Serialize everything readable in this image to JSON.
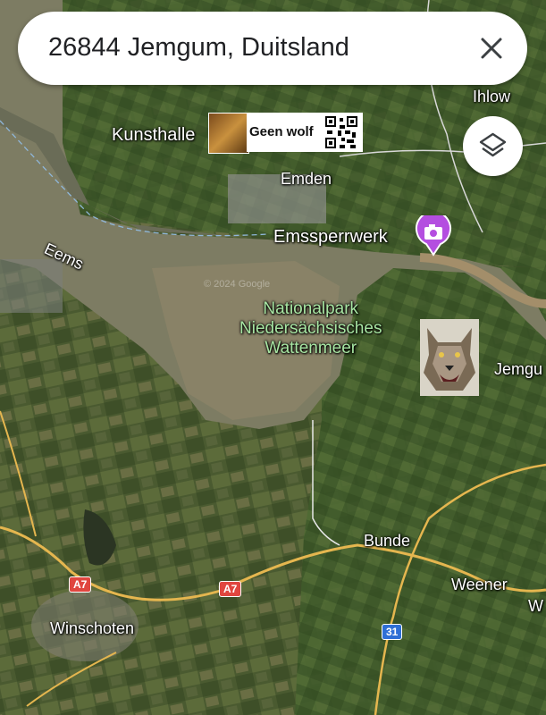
{
  "search": {
    "query": "26844 Jemgum, Duitsland"
  },
  "poi": {
    "geen_wolf": "Geen wolf"
  },
  "labels": {
    "ihlow": "Ihlow",
    "kunsthalle": "Kunsthalle",
    "emden": "Emden",
    "emssperrwerk": "Emssperrwerk",
    "eems": "Eems",
    "park_line1": "Nationalpark",
    "park_line2": "Niedersächsisches",
    "park_line3": "Wattenmeer",
    "jemgum": "Jemgu",
    "bunde": "Bunde",
    "weener": "Weener",
    "w": "W",
    "winschoten": "Winschoten",
    "copyright": "© 2024 Google"
  },
  "road_shields": {
    "a7": "A7",
    "r31": "31"
  },
  "icons": {
    "close": "close-icon",
    "layers": "layers-icon",
    "camera": "camera-pin-icon"
  },
  "colors": {
    "park_label": "#a8e6a3",
    "a7_shield": "#e0463f",
    "r31_shield": "#2f6fd6",
    "pin": "#b44ee0"
  }
}
